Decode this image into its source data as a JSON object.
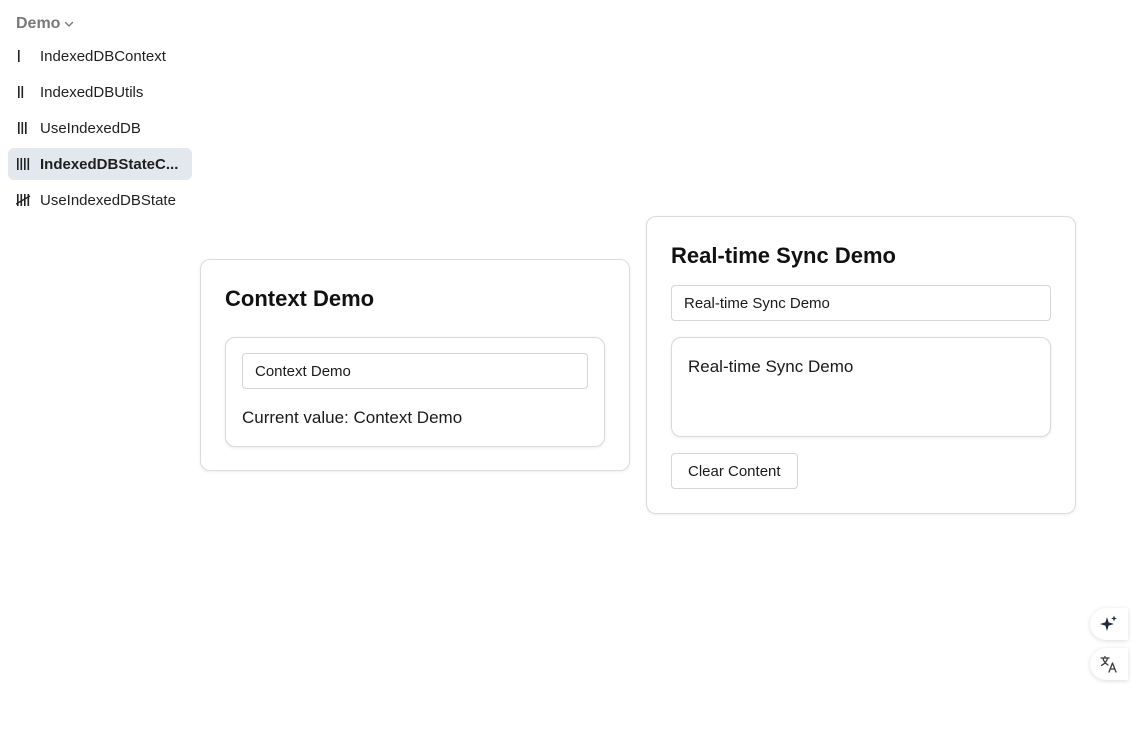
{
  "sidebar": {
    "section_label": "Demo",
    "items": [
      {
        "label": "IndexedDBContext",
        "icon": "roman-one-icon",
        "active": false
      },
      {
        "label": "IndexedDBUtils",
        "icon": "roman-two-icon",
        "active": false
      },
      {
        "label": "UseIndexedDB",
        "icon": "roman-three-icon",
        "active": false
      },
      {
        "label": "IndexedDBStateC...",
        "icon": "roman-four-icon",
        "active": true
      },
      {
        "label": "UseIndexedDBState",
        "icon": "tally-five-icon",
        "active": false
      }
    ]
  },
  "context_demo": {
    "title": "Context Demo",
    "input_value": "Context Demo",
    "current_value_text": "Current value: Context Demo"
  },
  "sync_demo": {
    "title": "Real-time Sync Demo",
    "input_value": "Real-time Sync Demo",
    "content_text": "Real-time Sync Demo",
    "clear_button_label": "Clear Content"
  },
  "floating_actions": [
    {
      "icon": "sparkle-icon"
    },
    {
      "icon": "translate-icon"
    }
  ],
  "colors": {
    "active_item_bg": "#e3e8ef",
    "section_label": "#7a7a7a",
    "border": "#dcdcdc"
  }
}
